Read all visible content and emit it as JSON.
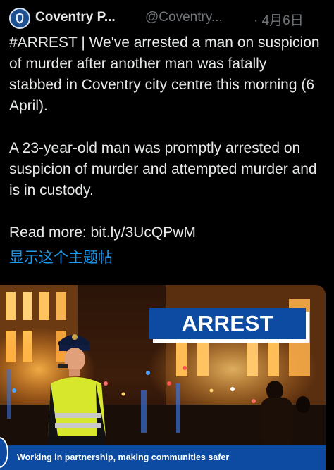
{
  "tweet": {
    "author_name": "Coventry P...",
    "author_handle": "@Coventry...",
    "time": "· 4月6日",
    "paragraph1": "#ARREST | We've arrested a man on suspicion of murder after another man was fatally stabbed in Coventry city centre this morning (6 April).",
    "paragraph2": "A 23-year-old man was promptly arrested on suspicion of murder and attempted murder and is in custody.",
    "paragraph3": "Read more: bit.ly/3UcQPwM",
    "show_thread": "显示这个主题帖"
  },
  "media": {
    "banner_text": "ARREST",
    "footer_text": "Working in partnership, making communities safer"
  },
  "colors": {
    "background": "#000000",
    "text": "#e7e9ea",
    "muted": "#71767b",
    "link": "#1d9bf0",
    "police_blue": "#0d4aa1"
  },
  "icons": {
    "avatar": "police-crest-icon"
  }
}
